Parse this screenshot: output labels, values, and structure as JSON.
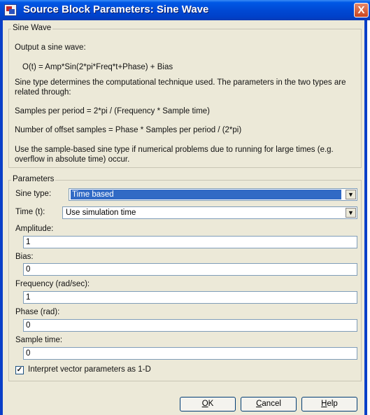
{
  "window": {
    "title": "Source Block Parameters: Sine Wave",
    "close_glyph": "X"
  },
  "sine_wave_group": {
    "legend": "Sine Wave",
    "intro": "Output a sine wave:",
    "formula": "O(t) = Amp*Sin(2*pi*Freq*t+Phase) + Bias",
    "type_desc": "Sine type determines the computational technique used. The parameters in the two types are related through:",
    "samples_per_period": "Samples per period = 2*pi / (Frequency * Sample time)",
    "offset_samples": "Number of offset samples = Phase * Samples per period / (2*pi)",
    "advice": "Use the sample-based sine type if numerical problems due to running for large times (e.g. overflow in absolute time) occur."
  },
  "parameters_group": {
    "legend": "Parameters",
    "sine_type": {
      "label": "Sine type:",
      "value": "Time based"
    },
    "time": {
      "label": "Time (t):",
      "value": "Use simulation time"
    },
    "amplitude": {
      "label": "Amplitude:",
      "value": "1"
    },
    "bias": {
      "label": "Bias:",
      "value": "0"
    },
    "frequency": {
      "label": "Frequency (rad/sec):",
      "value": "1"
    },
    "phase": {
      "label": "Phase (rad):",
      "value": "0"
    },
    "sample_time": {
      "label": "Sample time:",
      "value": "0"
    },
    "interpret_vector": {
      "label": "Interpret vector parameters as 1-D",
      "checked": true
    }
  },
  "buttons": {
    "ok": {
      "mnemonic": "O",
      "rest": "K"
    },
    "cancel": {
      "mnemonic": "C",
      "rest": "ancel"
    },
    "help": {
      "mnemonic": "H",
      "rest": "elp"
    }
  },
  "icons": {
    "app": "simulink-block-icon",
    "close": "close-icon",
    "dropdown": "chevron-down-icon",
    "check": "checkmark-icon"
  }
}
